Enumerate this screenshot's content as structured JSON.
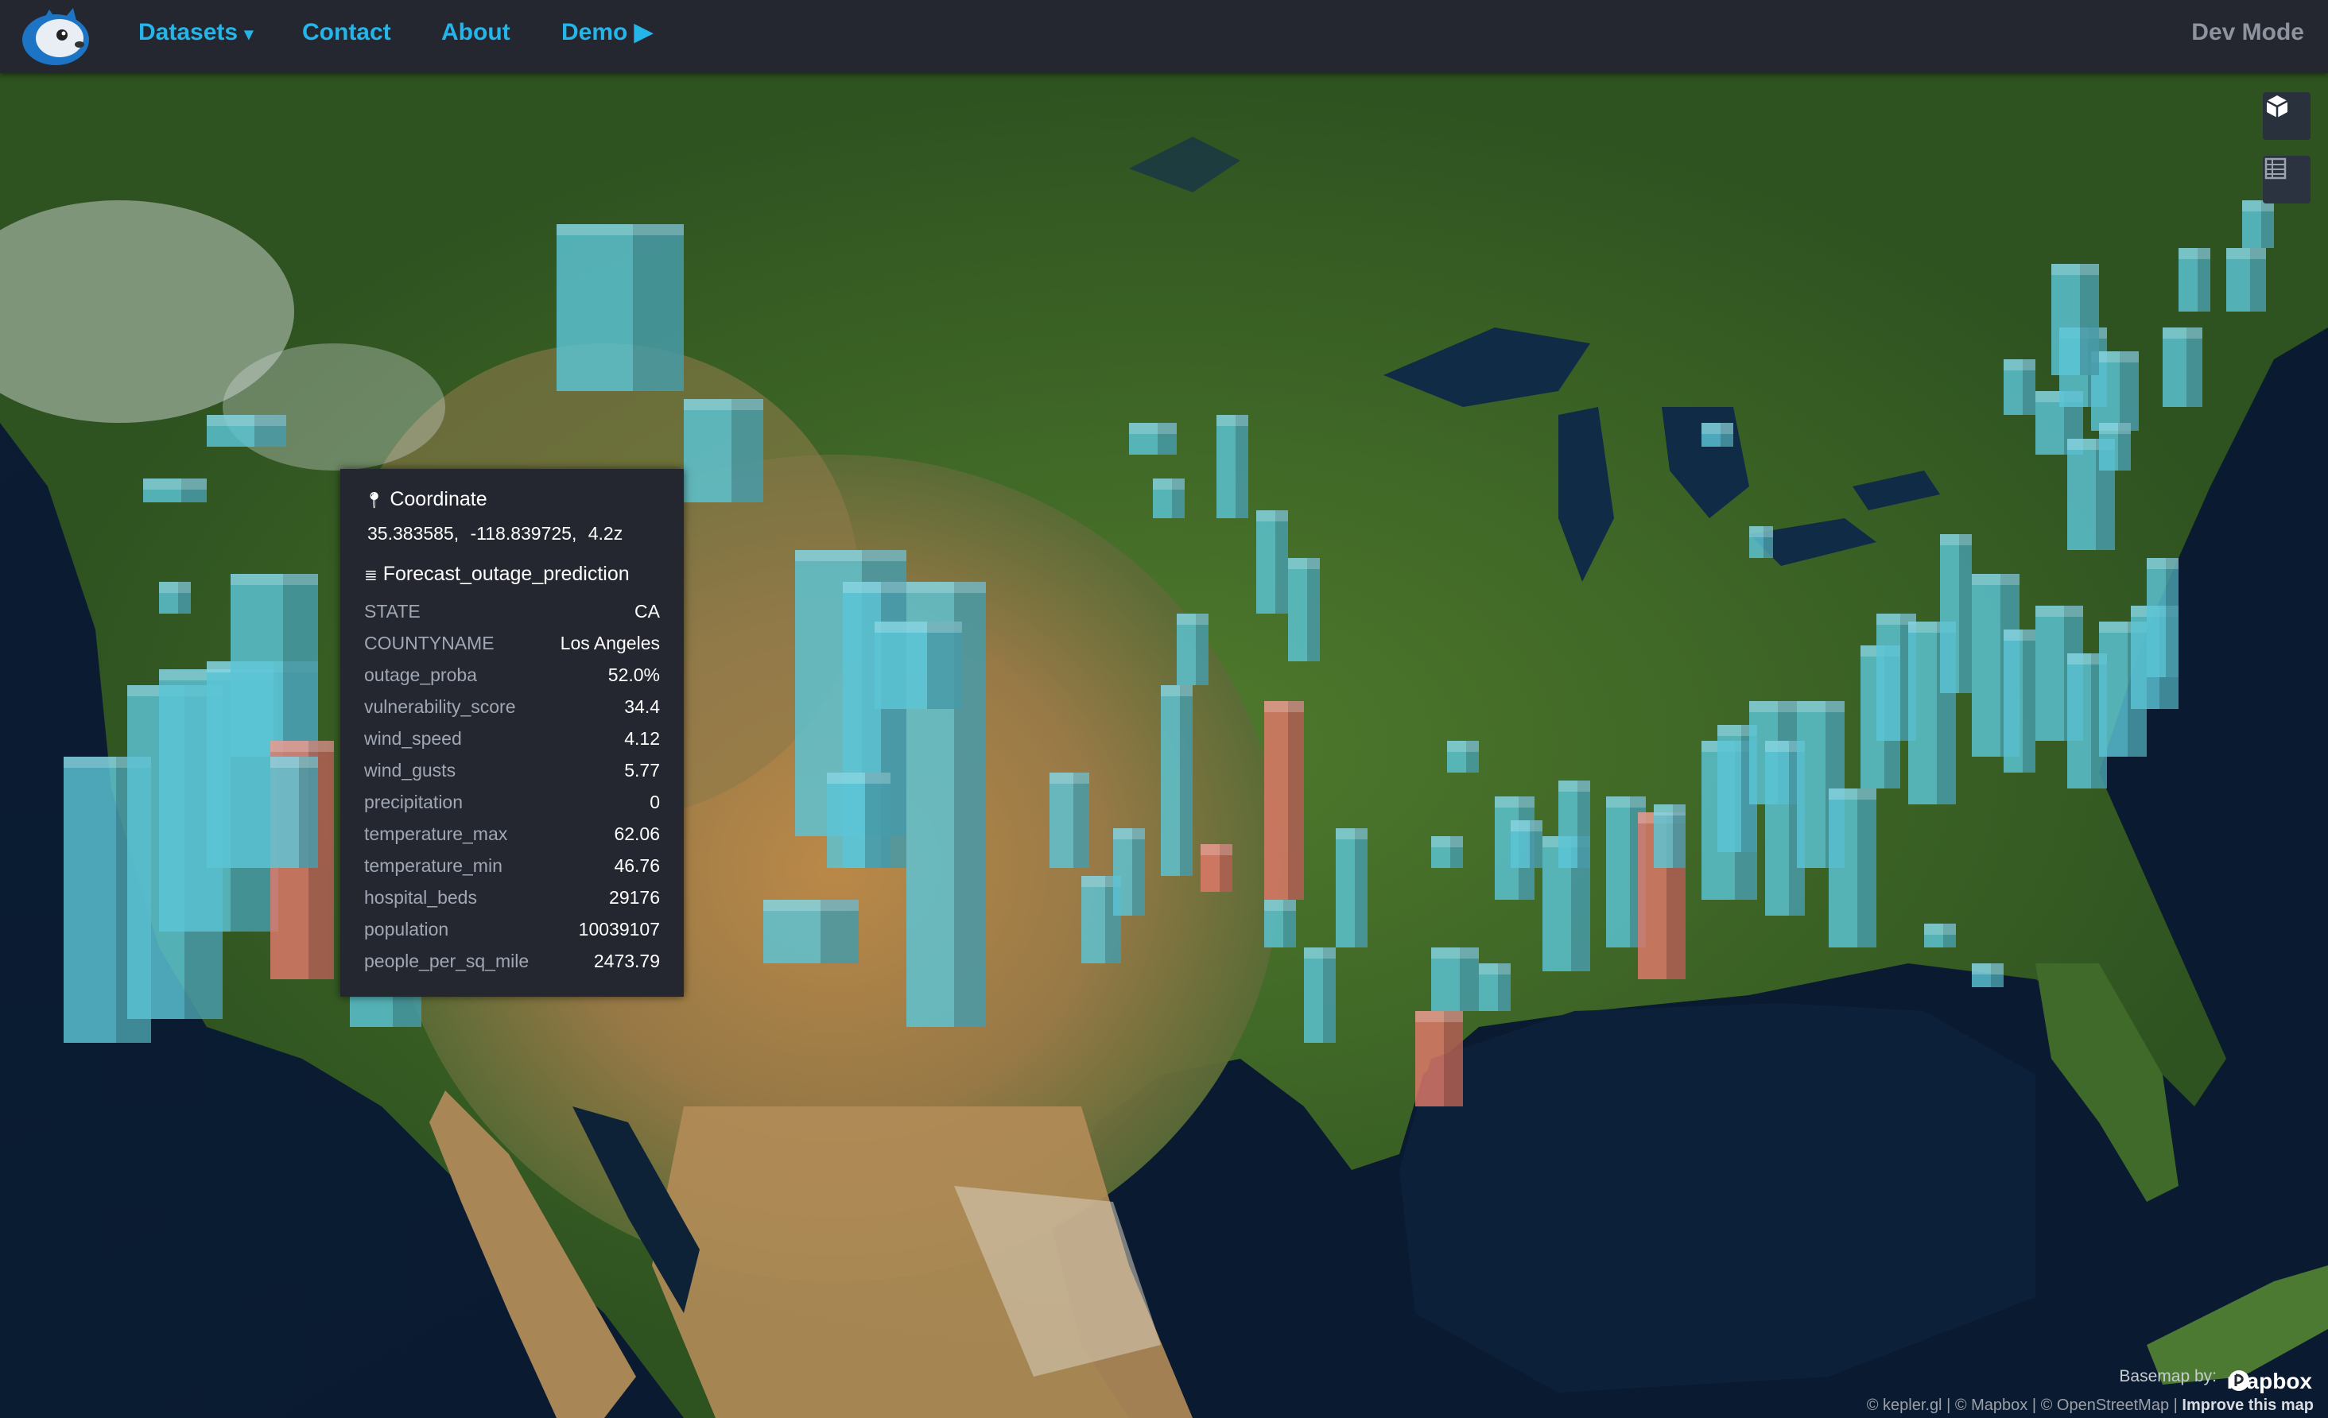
{
  "navbar": {
    "menu": [
      "Datasets",
      "Contact",
      "About",
      "Demo"
    ],
    "datasets_caret": "▾",
    "demo_play": "▶",
    "dev_mode": "Dev Mode",
    "logo_icon": "kepler-mascot-icon"
  },
  "tooltip": {
    "coordinate_icon": "pin-icon",
    "coordinate_title": "Coordinate",
    "coordinate_value": "35.383585,   -118.839725,   4.2z",
    "layer_icon": "layers-icon",
    "layer_title": "Forecast_outage_prediction",
    "fields": [
      {
        "key": "STATE",
        "value": "CA"
      },
      {
        "key": "COUNTYNAME",
        "value": "Los Angeles"
      },
      {
        "key": "outage_proba",
        "value": "52.0%"
      },
      {
        "key": "vulnerability_score",
        "value": "34.4"
      },
      {
        "key": "wind_speed",
        "value": "4.12"
      },
      {
        "key": "wind_gusts",
        "value": "5.77"
      },
      {
        "key": "precipitation",
        "value": "0"
      },
      {
        "key": "temperature_max",
        "value": "62.06"
      },
      {
        "key": "temperature_min",
        "value": "46.76"
      },
      {
        "key": "hospital_beds",
        "value": "29176"
      },
      {
        "key": "population",
        "value": "10039107"
      },
      {
        "key": "people_per_sq_mile",
        "value": "2473.79"
      }
    ]
  },
  "map_controls": [
    {
      "name": "3d-map-toggle-icon"
    },
    {
      "name": "data-table-icon"
    }
  ],
  "attribution": {
    "basemap_by": "Basemap by:",
    "mapbox_logo": "mapbox",
    "line_parts": [
      "© kepler.gl",
      "© Mapbox",
      "© OpenStreetMap"
    ],
    "improve": "Improve this map"
  },
  "colors": {
    "nav_bg": "#242730",
    "nav_link": "#25b5e8",
    "bar_blue": "#5cc4d6",
    "bar_red": "#e0796a"
  }
}
